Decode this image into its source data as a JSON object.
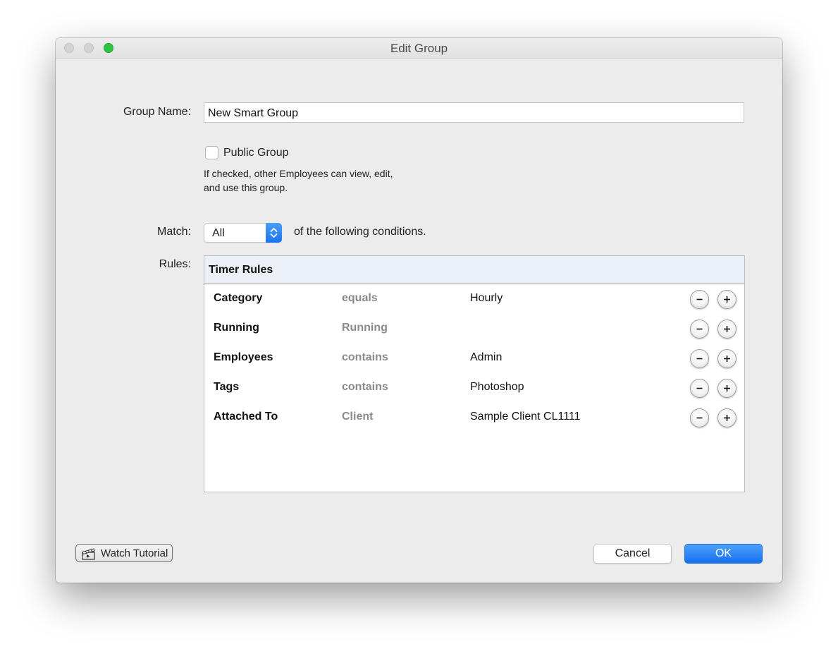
{
  "window": {
    "title": "Edit Group"
  },
  "group_name": {
    "label": "Group Name:",
    "value": "New Smart Group"
  },
  "public_group": {
    "label": "Public Group",
    "checked": false,
    "help_line1": "If checked, other Employees can view, edit,",
    "help_line2": "and use this group."
  },
  "match": {
    "label": "Match:",
    "selected": "All",
    "suffix": "of the following conditions."
  },
  "rules": {
    "label": "Rules:",
    "header": "Timer Rules",
    "rows": [
      {
        "field": "Category",
        "operator": "equals",
        "value": "Hourly"
      },
      {
        "field": "Running",
        "operator": "Running",
        "value": ""
      },
      {
        "field": "Employees",
        "operator": "contains",
        "value": "Admin"
      },
      {
        "field": "Tags",
        "operator": "contains",
        "value": "Photoshop"
      },
      {
        "field": "Attached To",
        "operator": "Client",
        "value": "Sample Client CL1111"
      }
    ]
  },
  "footer": {
    "tutorial_label": "Watch Tutorial",
    "cancel_label": "Cancel",
    "ok_label": "OK"
  },
  "colors": {
    "accent": "#1a73ee",
    "window_bg": "#ececec",
    "operator_text": "#8a8a8a"
  }
}
